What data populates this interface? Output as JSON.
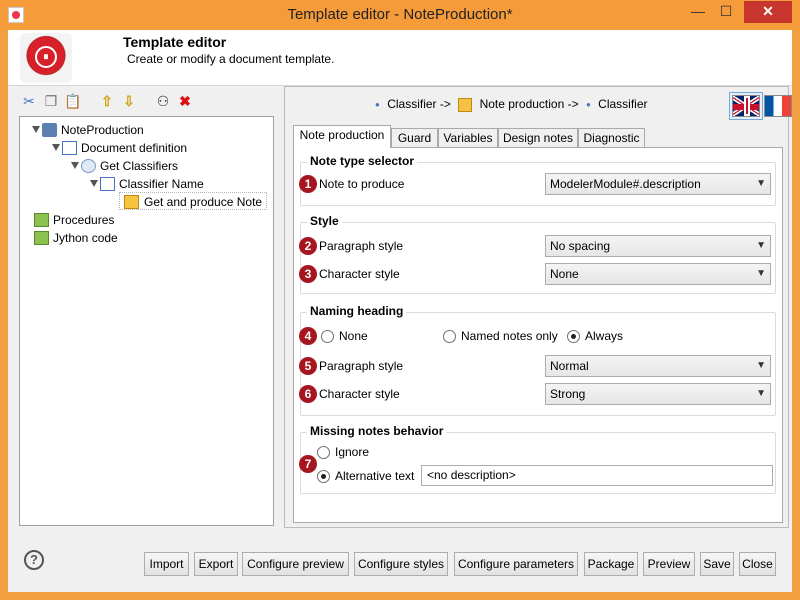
{
  "window": {
    "title": "Template editor - NoteProduction*",
    "minimize": "—",
    "maximize": "☐",
    "close": "✕"
  },
  "header": {
    "title": "Template editor",
    "subtitle": "Create or modify a document template."
  },
  "toolbar": {
    "icons": [
      "scissors-icon",
      "copy-icon",
      "paste-icon",
      "arrow-up-icon",
      "arrow-down-icon",
      "binoculars-icon",
      "delete-icon"
    ]
  },
  "tree": {
    "items": [
      {
        "label": "NoteProduction"
      },
      {
        "label": "Document definition"
      },
      {
        "label": "Get Classifiers"
      },
      {
        "label": "Classifier Name"
      },
      {
        "label": "Get and produce Note"
      },
      {
        "label": "Procedures"
      },
      {
        "label": "Jython code"
      }
    ]
  },
  "breadcrumb": {
    "part1": "Classifier ->",
    "part2": "Note production ->",
    "part3": "Classifier"
  },
  "tabs": [
    "Note production",
    "Guard",
    "Variables",
    "Design notes",
    "Diagnostic"
  ],
  "note_type": {
    "title": "Note type selector",
    "badge": "1",
    "label": "Note to produce",
    "value": "ModelerModule#.description"
  },
  "style": {
    "title": "Style",
    "paragraph": {
      "badge": "2",
      "label": "Paragraph style",
      "value": "No spacing"
    },
    "character": {
      "badge": "3",
      "label": "Character style",
      "value": "None"
    }
  },
  "naming": {
    "title": "Naming heading",
    "badge": "4",
    "options": [
      "None",
      "Named notes only",
      "Always"
    ],
    "selected": "Always",
    "paragraph": {
      "badge": "5",
      "label": "Paragraph style",
      "value": "Normal"
    },
    "character": {
      "badge": "6",
      "label": "Character style",
      "value": "Strong"
    }
  },
  "missing": {
    "title": "Missing notes behavior",
    "badge": "7",
    "ignore_label": "Ignore",
    "alt_label": "Alternative text",
    "alt_value": "<no description>"
  },
  "buttons": [
    "Import",
    "Export",
    "Configure preview",
    "Configure styles",
    "Configure parameters",
    "Package",
    "Preview",
    "Save",
    "Close"
  ],
  "help": "?"
}
